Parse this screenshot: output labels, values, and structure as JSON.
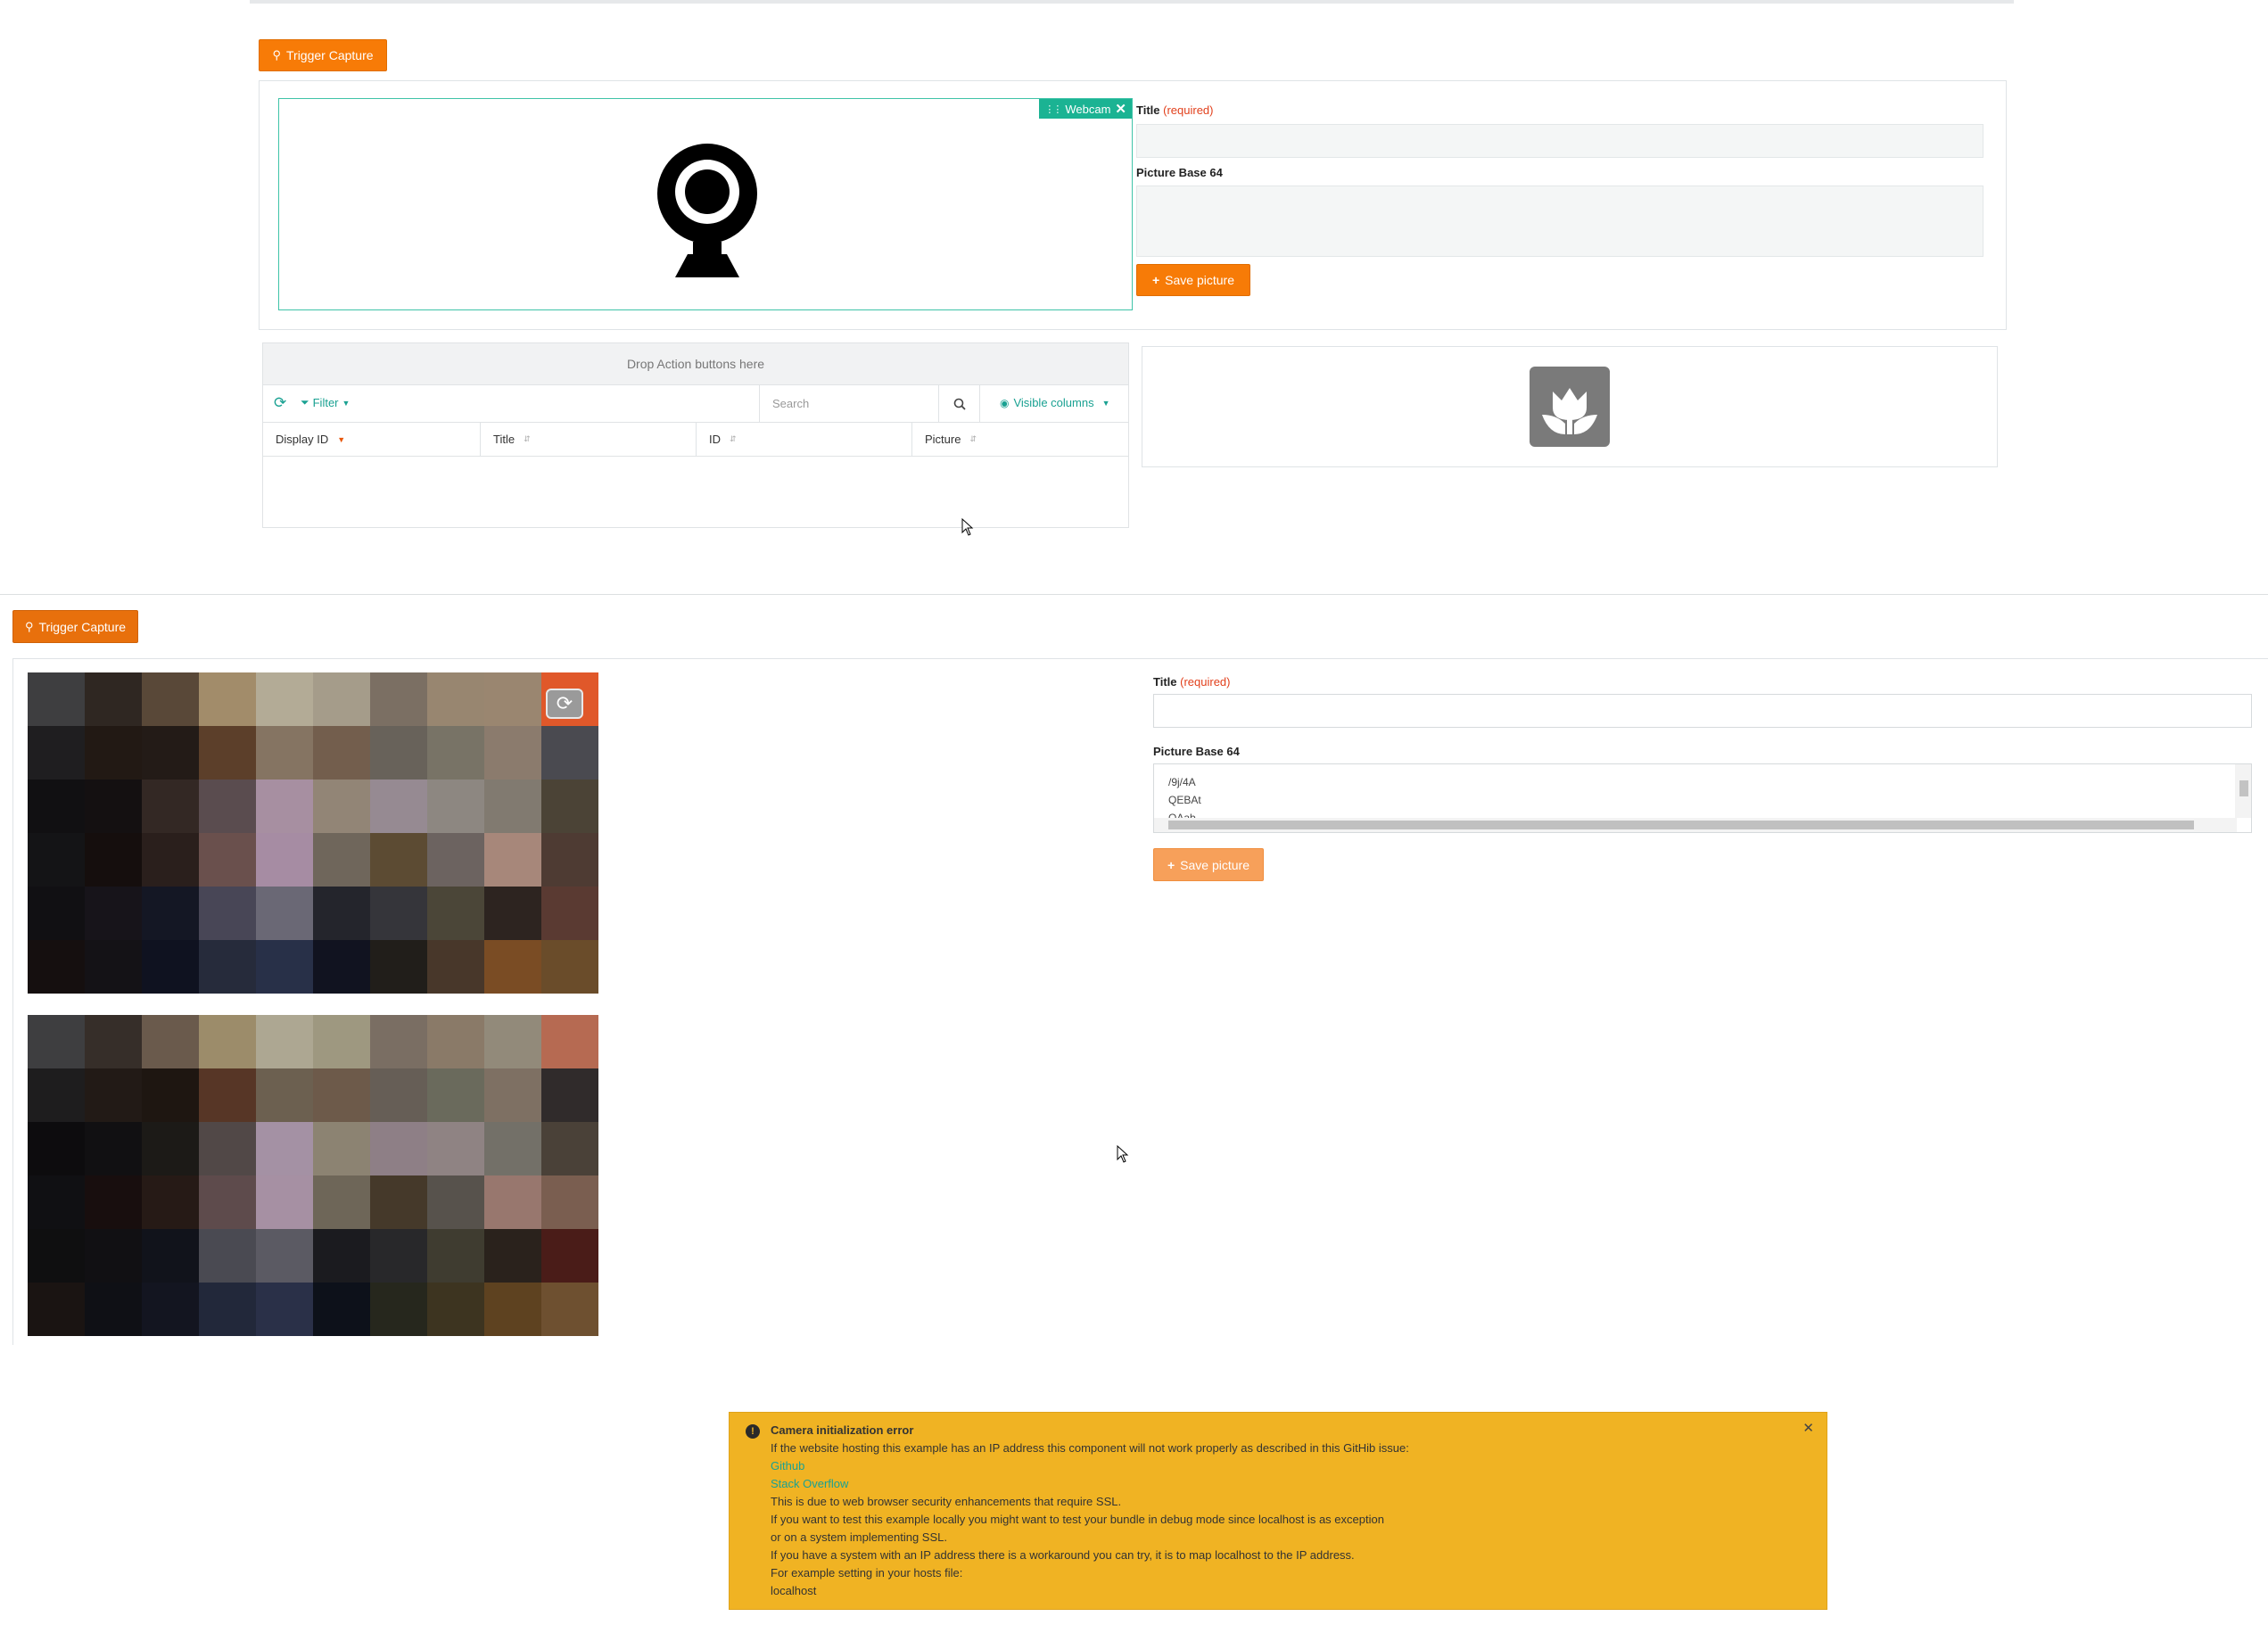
{
  "top": {
    "trigger_label": "Trigger Capture",
    "webcam_tag": "Webcam",
    "title_label": "Title",
    "required_label": "(required)",
    "picture_label": "Picture Base 64",
    "save_label": "Save picture",
    "drop_zone": "Drop Action buttons here",
    "filter_label": "Filter",
    "search_placeholder": "Search",
    "visible_columns": "Visible columns",
    "columns": [
      "Display ID",
      "Title",
      "ID",
      "Picture"
    ]
  },
  "bottom": {
    "trigger_label": "Trigger Capture",
    "title_label": "Title",
    "required_label": "(required)",
    "picture_label": "Picture Base 64",
    "textarea_lines": [
      "/9j/4A",
      "QEBAt",
      "QAab"
    ],
    "save_label": "Save picture"
  },
  "alert": {
    "title": "Camera initialization error",
    "lines": [
      "If the website hosting this example has an IP address this component will not work properly as described in this GitHib issue:",
      "Github",
      "Stack Overflow",
      "This is due to web browser security enhancements that require SSL.",
      "If you want to test this example locally you might want to test your bundle in debug mode since localhost is as exception",
      "or on a system implementing SSL.",
      "If you have a system with an IP address there is a workaround you can try, it is to map localhost to the IP address.",
      "For example setting in your hosts file:",
      "localhost"
    ]
  },
  "colors": {
    "accent_orange": "#f77b07",
    "teal": "#1aa192",
    "alert_bg": "#f0b323",
    "required_red": "#e2401c"
  },
  "icons": {
    "webcam": "webcam-icon",
    "flower": "flower-icon",
    "refresh": "refresh-icon",
    "search": "search-icon",
    "eye": "eye-icon",
    "camera_switch": "camera-switch-icon",
    "alert": "exclamation-icon",
    "close": "close-icon",
    "plus": "plus-icon",
    "pin": "pin-icon"
  },
  "camera_mosaic_1": [
    "#3e3e40",
    "#2f2722",
    "#594838",
    "#a28c6a",
    "#b3ab96",
    "#a59c8a",
    "#7b6f63",
    "#988670",
    "#9a8670",
    "#e0582a",
    "#1f1e20",
    "#221914",
    "#231b17",
    "#5c3f2a",
    "#857462",
    "#735e4d",
    "#68625a",
    "#787366",
    "#8b7b6d",
    "#4a4a50",
    "#111012",
    "#141011",
    "#332824",
    "#5a4c4f",
    "#a78fa1",
    "#928576",
    "#968a92",
    "#8d8781",
    "#817a70",
    "#4b4336",
    "#141416",
    "#150e0d",
    "#2a1f1c",
    "#6a504d",
    "#a68ca3",
    "#6f665b",
    "#5c4b33",
    "#6c6360",
    "#a7877a",
    "#4e3b33",
    "#111013",
    "#17141a",
    "#141724",
    "#484656",
    "#6a6875",
    "#24252c",
    "#35353a",
    "#4b4638",
    "#2d2420",
    "#5a3a32",
    "#150f0f",
    "#141216",
    "#0f1220",
    "#262b3b",
    "#283048",
    "#111320",
    "#211e1a",
    "#48372a",
    "#7a4c24",
    "#6a4c2a"
  ],
  "camera_mosaic_2": [
    "#3e3e40",
    "#362e29",
    "#6a5a4c",
    "#9c8c6a",
    "#ada792",
    "#9e9880",
    "#7a6e63",
    "#8a7a68",
    "#928a7a",
    "#b66a52",
    "#1e1d1e",
    "#221a16",
    "#1e1611",
    "#573626",
    "#6c6050",
    "#6d5a4a",
    "#665e56",
    "#6a6a5c",
    "#7e7063",
    "#302b2b",
    "#0d0c0e",
    "#111012",
    "#1c1a17",
    "#514847",
    "#a491a4",
    "#8c8372",
    "#8e7f86",
    "#8f8383",
    "#737068",
    "#4a4138",
    "#101013",
    "#180e0e",
    "#261a16",
    "#5e4b4c",
    "#a690a3",
    "#6e6658",
    "#45392a",
    "#57524c",
    "#98776e",
    "#7a5e50",
    "#0f0f10",
    "#111013",
    "#11131b",
    "#4a4a52",
    "#5b5a63",
    "#1b1b1f",
    "#28282a",
    "#3f3c30",
    "#2a221c",
    "#4a1c18",
    "#1a1412",
    "#0f1015",
    "#131520",
    "#22283a",
    "#2a3048",
    "#0d111a",
    "#26271d",
    "#3d3420",
    "#5e4220",
    "#6e5030"
  ]
}
